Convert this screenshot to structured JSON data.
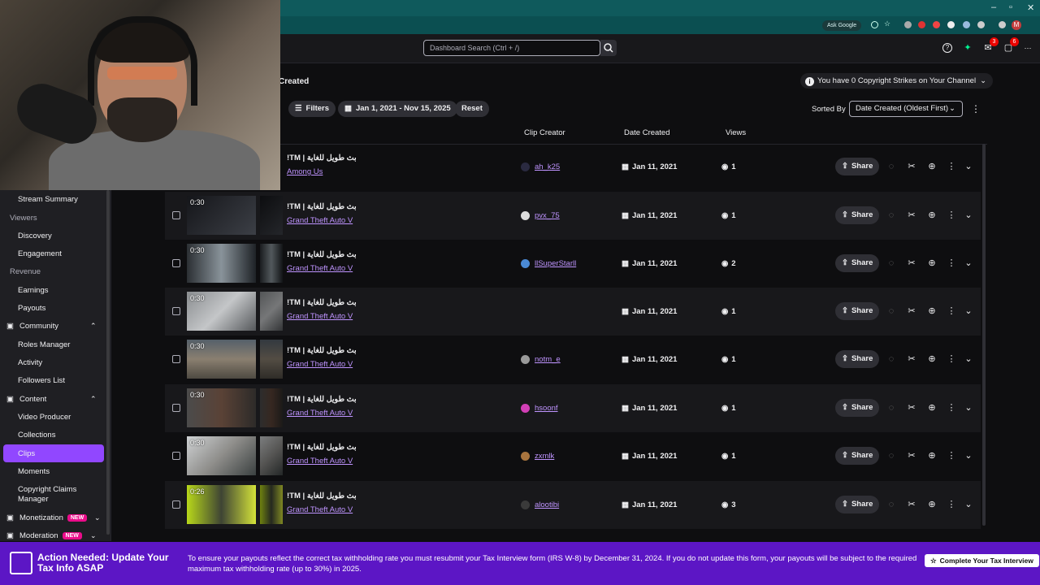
{
  "browser": {
    "ask_google_label": "Ask Google",
    "profile_initial": "M",
    "window_controls": [
      "–",
      "▫",
      "✕"
    ]
  },
  "topnav": {
    "search_placeholder": "Dashboard Search (Ctrl + /)",
    "inbox_count": "3",
    "notifications_count": "6"
  },
  "sidebar": {
    "items": [
      {
        "type": "item",
        "label": "Stream Summary"
      },
      {
        "type": "head",
        "label": "Viewers"
      },
      {
        "type": "item",
        "label": "Discovery"
      },
      {
        "type": "item",
        "label": "Engagement"
      },
      {
        "type": "head",
        "label": "Revenue"
      },
      {
        "type": "item",
        "label": "Earnings"
      },
      {
        "type": "item",
        "label": "Payouts"
      },
      {
        "type": "group",
        "label": "Community"
      },
      {
        "type": "item",
        "label": "Roles Manager"
      },
      {
        "type": "item",
        "label": "Activity"
      },
      {
        "type": "item",
        "label": "Followers List"
      },
      {
        "type": "group",
        "label": "Content"
      },
      {
        "type": "item",
        "label": "Video Producer"
      },
      {
        "type": "item",
        "label": "Collections"
      },
      {
        "type": "item",
        "label": "Clips",
        "active": true
      },
      {
        "type": "item",
        "label": "Moments"
      },
      {
        "type": "item",
        "label": "Copyright Claims Manager"
      },
      {
        "type": "group",
        "label": "Monetization",
        "badge": "NEW"
      },
      {
        "type": "group",
        "label": "Moderation",
        "badge": "NEW"
      }
    ]
  },
  "main": {
    "page_title_fragment": "Created",
    "strikes_text": "You have 0 Copyright Strikes on Your Channel",
    "filters_label": "Filters",
    "date_range_label": "Jan 1, 2021 - Nov 15, 2025",
    "reset_label": "Reset",
    "sorted_by_label": "Sorted By",
    "sort_value": "Date Created (Oldest First)",
    "columns": {
      "creator": "Clip Creator",
      "date": "Date Created",
      "views": "Views"
    },
    "share_label": "Share",
    "rows": [
      {
        "title": "بث طويل للغاية | TM!",
        "game": "Among Us",
        "duration": "",
        "creator": "ah_k25",
        "date": "Jan 11, 2021",
        "views": "1",
        "avatar_color": "#2a2a40"
      },
      {
        "title": "بث طويل للغاية | TM!",
        "game": "Grand Theft Auto V",
        "duration": "0:30",
        "creator": "pvx_75",
        "date": "Jan 11, 2021",
        "views": "1",
        "avatar_color": "#dcdcdc"
      },
      {
        "title": "بث طويل للغاية | TM!",
        "game": "Grand Theft Auto V",
        "duration": "0:30",
        "creator": "llSuperStarll",
        "date": "Jan 11, 2021",
        "views": "2",
        "avatar_color": "#4a8ad6"
      },
      {
        "title": "بث طويل للغاية | TM!",
        "game": "Grand Theft Auto V",
        "duration": "0:30",
        "creator": "",
        "date": "Jan 11, 2021",
        "views": "1",
        "avatar_color": ""
      },
      {
        "title": "بث طويل للغاية | TM!",
        "game": "Grand Theft Auto V",
        "duration": "0:30",
        "creator": "notm_e",
        "date": "Jan 11, 2021",
        "views": "1",
        "avatar_color": "#9a9a9a"
      },
      {
        "title": "بث طويل للغاية | TM!",
        "game": "Grand Theft Auto V",
        "duration": "0:30",
        "creator": "hsoonf",
        "date": "Jan 11, 2021",
        "views": "1",
        "avatar_color": "#d23fb6"
      },
      {
        "title": "بث طويل للغاية | TM!",
        "game": "Grand Theft Auto V",
        "duration": "0:30",
        "creator": "zxmlk",
        "date": "Jan 11, 2021",
        "views": "1",
        "avatar_color": "#a8743e"
      },
      {
        "title": "بث طويل للغاية | TM!",
        "game": "Grand Theft Auto V",
        "duration": "0:26",
        "creator": "alootibi",
        "date": "Jan 11, 2021",
        "views": "3",
        "avatar_color": "#3a3a3a"
      }
    ]
  },
  "banner": {
    "title": "Action Needed: Update Your Tax Info ASAP",
    "text": "To ensure your payouts reflect the correct tax withholding rate you must resubmit your Tax Interview form (IRS W-8) by December 31, 2024. If you do not update this form, your payouts will be subject to the required maximum tax withholding rate (up to 30%) in 2025.",
    "button_label": "Complete Your Tax Interview"
  },
  "colors": {
    "accent": "#9147ff",
    "link": "#bf94ff",
    "banner": "#5c16c5",
    "browser_frame": "#0f5a5c"
  }
}
